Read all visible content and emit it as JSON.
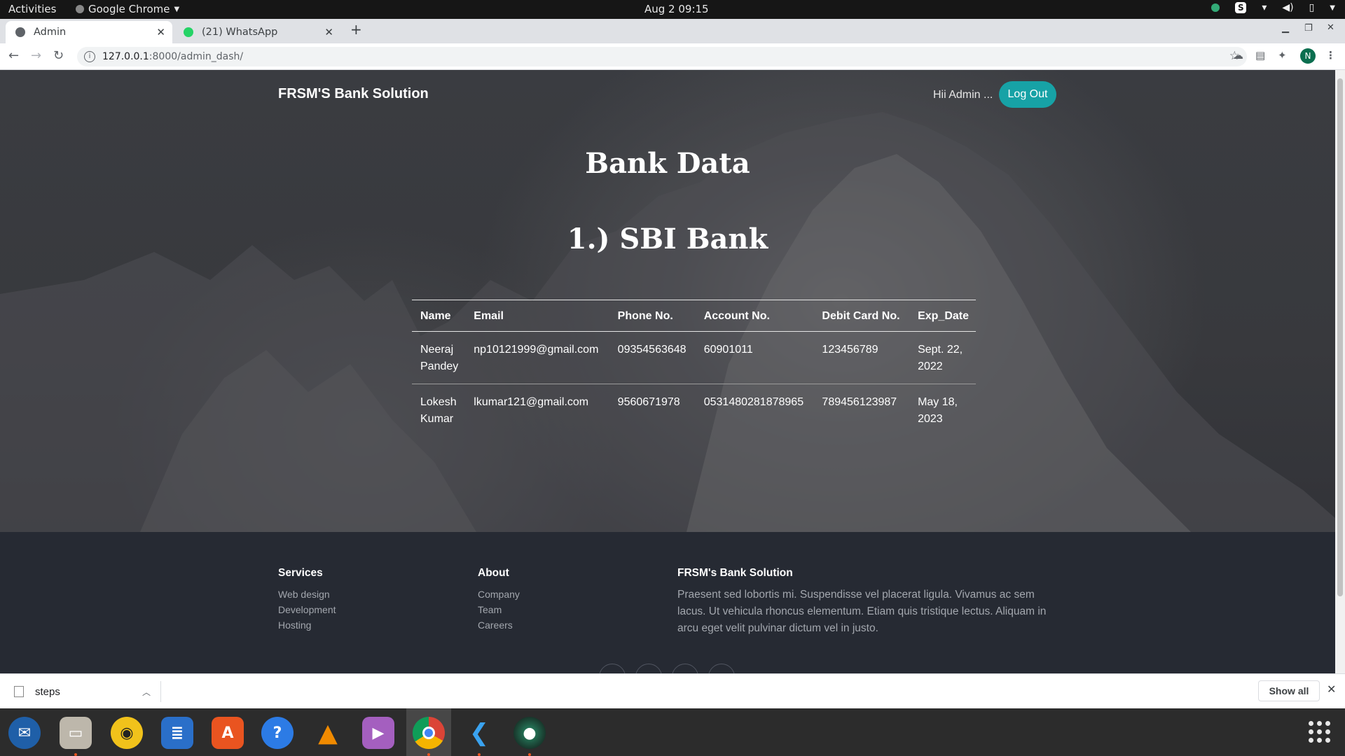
{
  "system": {
    "activities": "Activities",
    "app_name": "Google Chrome",
    "clock": "Aug 2  09:15"
  },
  "browser": {
    "tabs": [
      {
        "label": "Admin"
      },
      {
        "label": "(21) WhatsApp"
      }
    ],
    "url_host": "127.0.0.1",
    "url_rest": ":8000/admin_dash/",
    "profile_initial": "N"
  },
  "page": {
    "brand": "FRSM'S Bank Solution",
    "greeting": "Hii Admin ...",
    "logout_label": "Log Out",
    "title": "Bank Data",
    "section_title": "1.) SBI Bank",
    "table": {
      "headers": [
        "Name",
        "Email",
        "Phone No.",
        "Account No.",
        "Debit Card No.",
        "Exp_Date"
      ],
      "rows": [
        [
          "Neeraj Pandey",
          "np10121999@gmail.com",
          "09354563648",
          "60901011",
          "123456789",
          "Sept. 22, 2022"
        ],
        [
          "Lokesh Kumar",
          "lkumar121@gmail.com",
          "9560671978",
          "0531480281878965",
          "789456123987",
          "May 18, 2023"
        ]
      ]
    },
    "footer": {
      "services": {
        "heading": "Services",
        "links": [
          "Web design",
          "Development",
          "Hosting"
        ]
      },
      "about": {
        "heading": "About",
        "links": [
          "Company",
          "Team",
          "Careers"
        ]
      },
      "company": {
        "heading": "FRSM's  Bank Solution",
        "text": "Praesent sed lobortis mi. Suspendisse vel placerat ligula. Vivamus ac sem lacus. Ut vehicula rhoncus elementum. Etiam quis tristique lectus. Aliquam in arcu eget velit pulvinar dictum vel in justo."
      }
    }
  },
  "downloads": {
    "file_name": "steps",
    "show_all": "Show all"
  },
  "colors": {
    "accent": "#17a2a6",
    "footer_bg": "#262a33",
    "hero_bg": "#3a3c41"
  }
}
